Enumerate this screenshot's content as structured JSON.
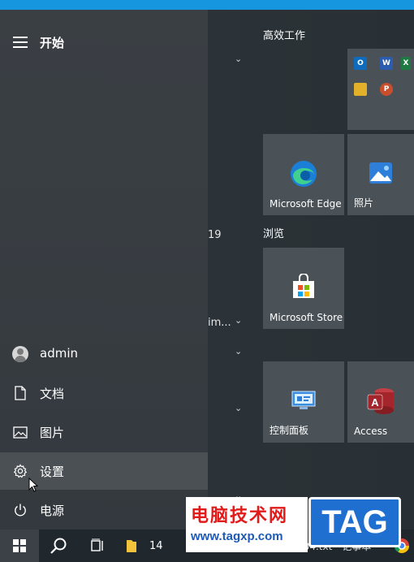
{
  "start_menu": {
    "title": "开始",
    "nav_items": [
      {
        "id": "user",
        "label": "admin",
        "icon": "user-avatar-icon"
      },
      {
        "id": "documents",
        "label": "文档",
        "icon": "document-icon"
      },
      {
        "id": "pictures",
        "label": "图片",
        "icon": "picture-icon"
      },
      {
        "id": "settings",
        "label": "设置",
        "icon": "gear-icon",
        "active": true
      },
      {
        "id": "power",
        "label": "电源",
        "icon": "power-icon"
      }
    ],
    "list_fragments": [
      "19",
      "im..."
    ]
  },
  "tiles": {
    "groups": [
      {
        "title": "高效工作"
      },
      {
        "title": "浏览"
      }
    ],
    "items": [
      {
        "label": "Microsoft Edge",
        "icon": "edge-icon"
      },
      {
        "label": "照片",
        "icon": "photos-icon"
      },
      {
        "label": "Microsoft Store",
        "icon": "store-icon"
      },
      {
        "label": "控制面板",
        "icon": "control-panel-icon"
      },
      {
        "label": "Access",
        "icon": "access-icon"
      }
    ],
    "office_mini_letters": [
      "O",
      "W",
      "X",
      "P"
    ]
  },
  "taskbar": {
    "folder_count": "14",
    "items": [
      {
        "icon": "windows-start-icon"
      },
      {
        "icon": "search-icon"
      },
      {
        "icon": "task-view-icon"
      },
      {
        "icon": "file-explorer-icon"
      }
    ],
    "partial_text": "day304.txt - 记事本"
  },
  "watermark": {
    "title": "电脑技术网",
    "url": "www.tagxp.com",
    "tag": "TAG"
  },
  "colors": {
    "accent_strip": "#1796e0",
    "tile_bg": "#4a5258",
    "edge_blue": "#1b7fd6",
    "access_red": "#a4262c"
  }
}
